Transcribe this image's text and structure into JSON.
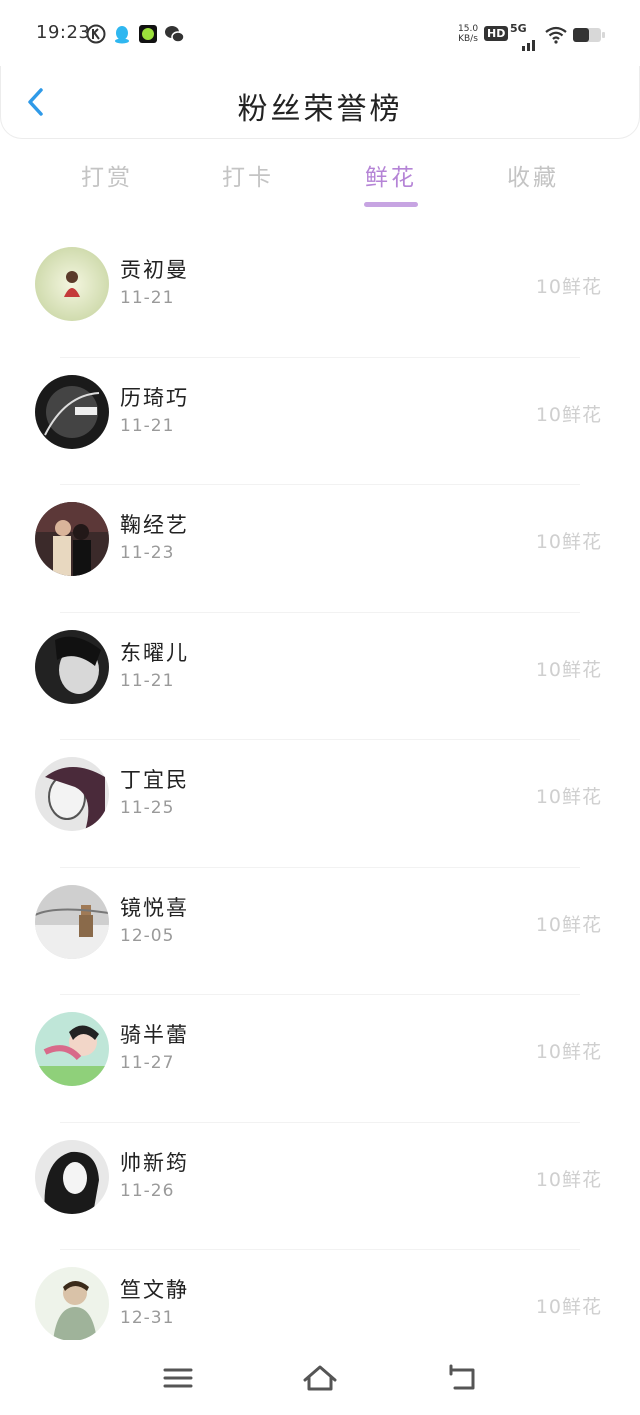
{
  "status": {
    "time": "19:23",
    "speed_value": "15.0",
    "speed_unit": "KB/s",
    "hd": "HD",
    "network": "5G"
  },
  "header": {
    "title": "粉丝荣誉榜"
  },
  "tabs": [
    {
      "label": "打赏",
      "active": false
    },
    {
      "label": "打卡",
      "active": false
    },
    {
      "label": "鲜花",
      "active": true
    },
    {
      "label": "收藏",
      "active": false
    }
  ],
  "fans": [
    {
      "name": "贡初曼",
      "date": "11-21",
      "score": "10鲜花"
    },
    {
      "name": "历琦巧",
      "date": "11-21",
      "score": "10鲜花"
    },
    {
      "name": "鞠经艺",
      "date": "11-23",
      "score": "10鲜花"
    },
    {
      "name": "东曜儿",
      "date": "11-21",
      "score": "10鲜花"
    },
    {
      "name": "丁宜民",
      "date": "11-25",
      "score": "10鲜花"
    },
    {
      "name": "镜悦喜",
      "date": "12-05",
      "score": "10鲜花"
    },
    {
      "name": "骑半蕾",
      "date": "11-27",
      "score": "10鲜花"
    },
    {
      "name": "帅新筠",
      "date": "11-26",
      "score": "10鲜花"
    },
    {
      "name": "笪文静",
      "date": "12-31",
      "score": "10鲜花"
    }
  ],
  "colors": {
    "accent": "#b584d6",
    "back_arrow": "#2f9ae8",
    "inactive_tab": "#c4c4c4"
  },
  "icons": {
    "back": "chevron-left-icon",
    "menu": "menu-icon",
    "home": "home-icon",
    "return": "return-icon"
  }
}
